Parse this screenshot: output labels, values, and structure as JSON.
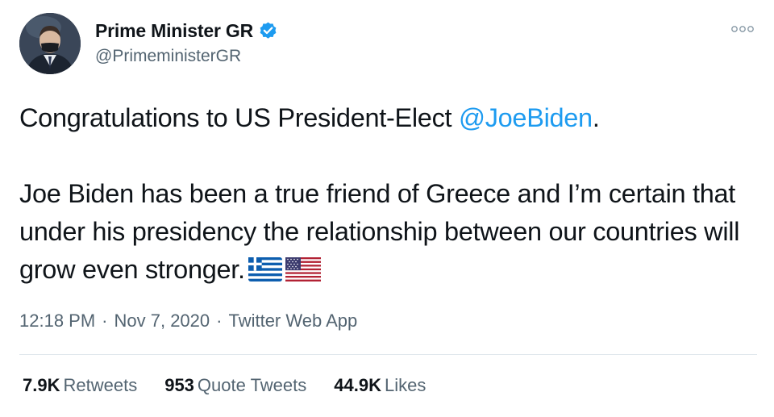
{
  "author": {
    "display_name": "Prime Minister GR",
    "handle": "@PrimeministerGR",
    "verified": true,
    "avatar_icon": "profile-photo"
  },
  "more_icon": "more-options-icon",
  "tweet": {
    "line1_prefix": "Congratulations to US President-Elect ",
    "mention": "@JoeBiden",
    "line1_suffix": ".",
    "body": "Joe Biden has been a true friend of Greece and I’m certain that under his presidency the relationship between our countries will grow even stronger.",
    "flags": [
      "greece-flag-icon",
      "usa-flag-icon"
    ]
  },
  "meta": {
    "time": "12:18 PM",
    "separator": "·",
    "date": "Nov 7, 2020",
    "source": "Twitter Web App"
  },
  "stats": {
    "retweets_count": "7.9K",
    "retweets_label": "Retweets",
    "quotes_count": "953",
    "quotes_label": "Quote Tweets",
    "likes_count": "44.9K",
    "likes_label": "Likes"
  },
  "colors": {
    "link": "#1d9bf0",
    "secondary_text": "#536471",
    "primary_text": "#0f1419",
    "verified_badge": "#1d9bf0"
  }
}
